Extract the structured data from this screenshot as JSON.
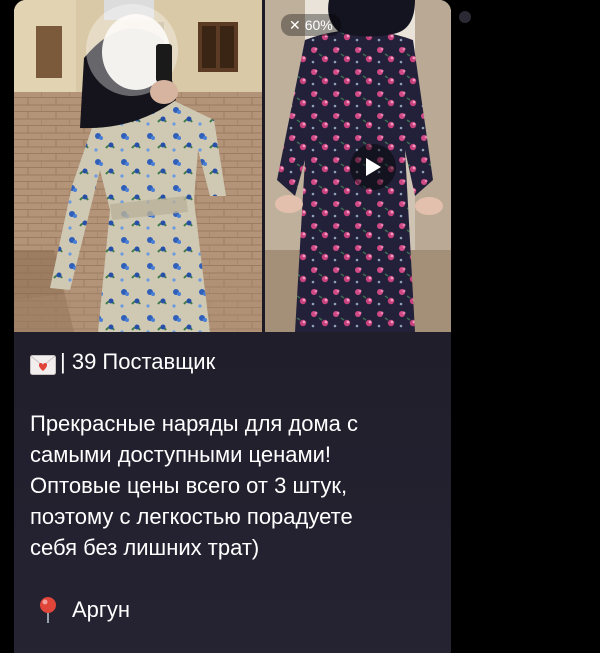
{
  "video_badge": {
    "muted_symbol": "✕",
    "label": "60%"
  },
  "message": {
    "header": "| 39 Поставщик",
    "body": "Прекрасные наряды для дома с\nсамыми доступными ценами!\nОптовые цены всего от 3 штук,\nпоэтому с легкостью порадуете\nсебя без лишних трат)",
    "location": "Аргун"
  },
  "colors": {
    "bubble": "#1f1d29",
    "text": "#ffffff",
    "background": "#000000",
    "pin_red": "#e0453a"
  },
  "icons": {
    "envelope": "love-letter-icon",
    "pin": "round-pushpin-icon",
    "play": "play-icon",
    "muted": "muted-icon"
  }
}
